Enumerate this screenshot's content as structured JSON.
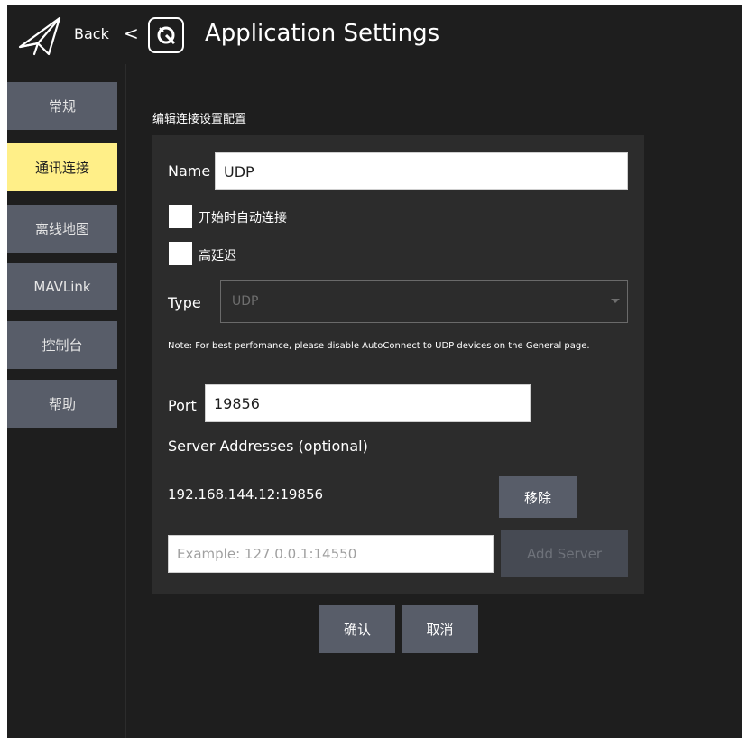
{
  "header": {
    "back_label": "Back",
    "back_chevron": "<",
    "title": "Application Settings",
    "icons": {
      "back": "paper-plane-icon",
      "logo": "qgc-logo-icon"
    }
  },
  "sidebar": {
    "items": [
      {
        "label": "常规",
        "active": false
      },
      {
        "label": "通讯连接",
        "active": true
      },
      {
        "label": "离线地图",
        "active": false
      },
      {
        "label": "MAVLink",
        "active": false
      },
      {
        "label": "控制台",
        "active": false
      },
      {
        "label": "帮助",
        "active": false
      }
    ]
  },
  "editor": {
    "section_title": "编辑连接设置配置",
    "name_label": "Name",
    "name_value": "UDP",
    "auto_connect_label": "开始时自动连接",
    "auto_connect_checked": false,
    "high_latency_label": "高延迟",
    "high_latency_checked": false,
    "type_label": "Type",
    "type_value": "UDP",
    "note": "Note: For best perfomance, please disable AutoConnect to UDP devices on the General page.",
    "port_label": "Port",
    "port_value": "19856",
    "server_addresses_label": "Server Addresses (optional)",
    "servers": [
      {
        "address": "192.168.144.12:19856",
        "remove_label": "移除"
      }
    ],
    "new_server_placeholder": "Example: 127.0.0.1:14550",
    "add_server_label": "Add Server"
  },
  "footer": {
    "ok_label": "确认",
    "cancel_label": "取消"
  },
  "colors": {
    "background": "#1e1e1e",
    "panel": "#2c2c2c",
    "button": "#585d69",
    "active_tab": "#ffef88",
    "text": "#ffffff"
  }
}
